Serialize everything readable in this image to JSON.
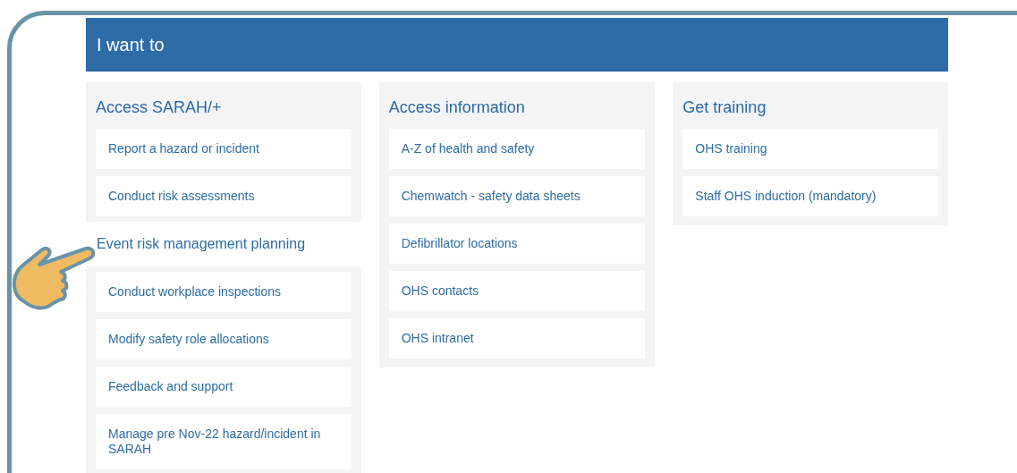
{
  "banner": {
    "title": "I want to"
  },
  "columns": [
    {
      "heading": "Access SARAH/+",
      "items": [
        {
          "label": "Report a hazard or incident",
          "selected": false
        },
        {
          "label": "Conduct risk assessments",
          "selected": false
        },
        {
          "label": "Event risk management planning",
          "selected": true
        },
        {
          "label": "Conduct workplace inspections",
          "selected": false
        },
        {
          "label": "Modify safety role allocations",
          "selected": false
        },
        {
          "label": "Feedback and support",
          "selected": false
        },
        {
          "label": "Manage pre Nov-22 hazard/incident in SARAH",
          "selected": false
        }
      ]
    },
    {
      "heading": "Access information",
      "items": [
        {
          "label": "A-Z of health and safety",
          "selected": false
        },
        {
          "label": "Chemwatch - safety data sheets",
          "selected": false
        },
        {
          "label": "Defibrillator locations",
          "selected": false
        },
        {
          "label": "OHS contacts",
          "selected": false
        },
        {
          "label": "OHS intranet",
          "selected": false
        }
      ]
    },
    {
      "heading": "Get training",
      "items": [
        {
          "label": "OHS training",
          "selected": false
        },
        {
          "label": "Staff OHS induction (mandatory)",
          "selected": false
        }
      ]
    }
  ]
}
